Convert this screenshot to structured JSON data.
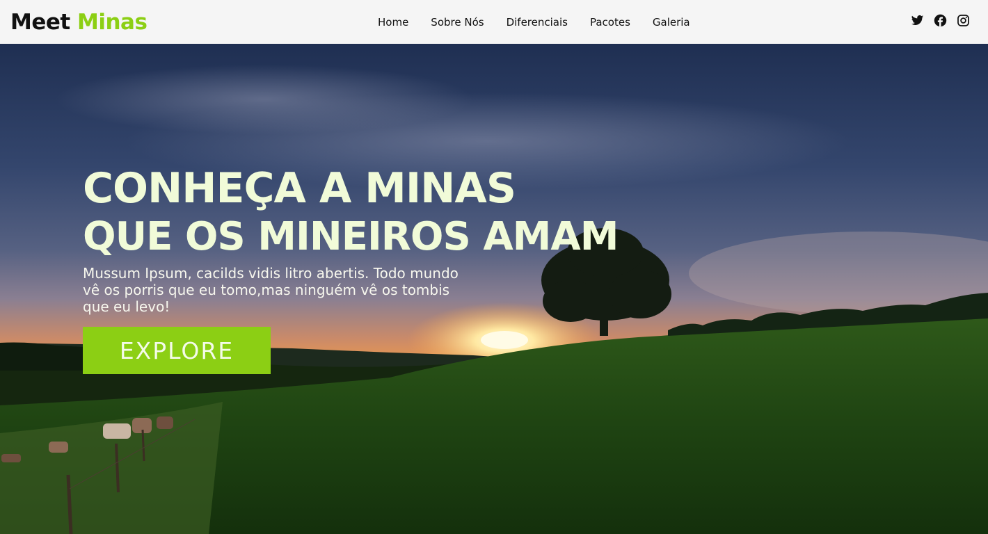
{
  "brand": {
    "part1": "Meet",
    "part2": "Minas"
  },
  "nav": {
    "home": "Home",
    "about": "Sobre Nós",
    "differentials": "Diferenciais",
    "packages": "Pacotes",
    "gallery": "Galeria"
  },
  "social": [
    "twitter-icon",
    "facebook-icon",
    "instagram-icon"
  ],
  "hero": {
    "title_line1": "CONHEÇA A MINAS",
    "title_line2": "QUE OS MINEIROS AMAM",
    "subtitle": "Mussum Ipsum, cacilds vidis litro abertis. Todo mundo vê os porris que eu tomo,mas ninguém vê os tombis que eu levo!",
    "cta": "EXPLORE"
  },
  "colors": {
    "accent": "#8ccf14",
    "header_bg": "#f5f5f5",
    "title": "#f1fbd8"
  }
}
